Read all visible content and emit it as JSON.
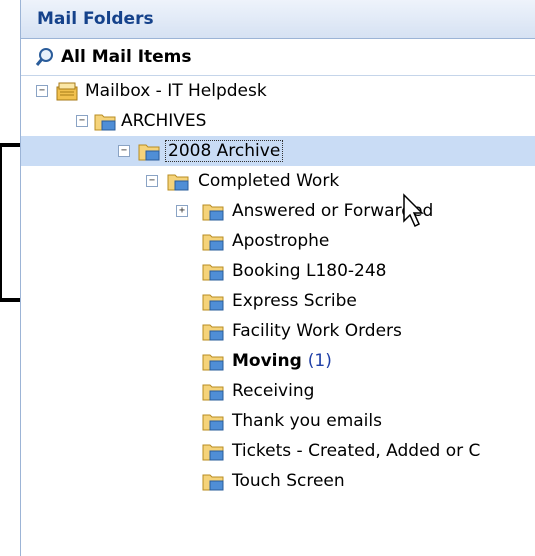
{
  "pane": {
    "header": "Mail Folders",
    "all_items": "All Mail Items",
    "mailbox": "Mailbox - IT Helpdesk",
    "archives": "ARCHIVES",
    "archive_2008": "2008 Archive",
    "completed_work": "Completed Work",
    "folders": [
      "Answered or Forwarded",
      "Apostrophe",
      "Booking L180-248",
      "Express Scribe",
      "Facility Work Orders",
      "Moving",
      "Receiving",
      "Thank you emails",
      "Tickets - Created, Added or C",
      "Touch Screen"
    ],
    "moving_count": "(1)"
  },
  "colors": {
    "header_text": "#15428b",
    "selection": "#c9dcf5",
    "unread_count": "#1f3fa6"
  }
}
